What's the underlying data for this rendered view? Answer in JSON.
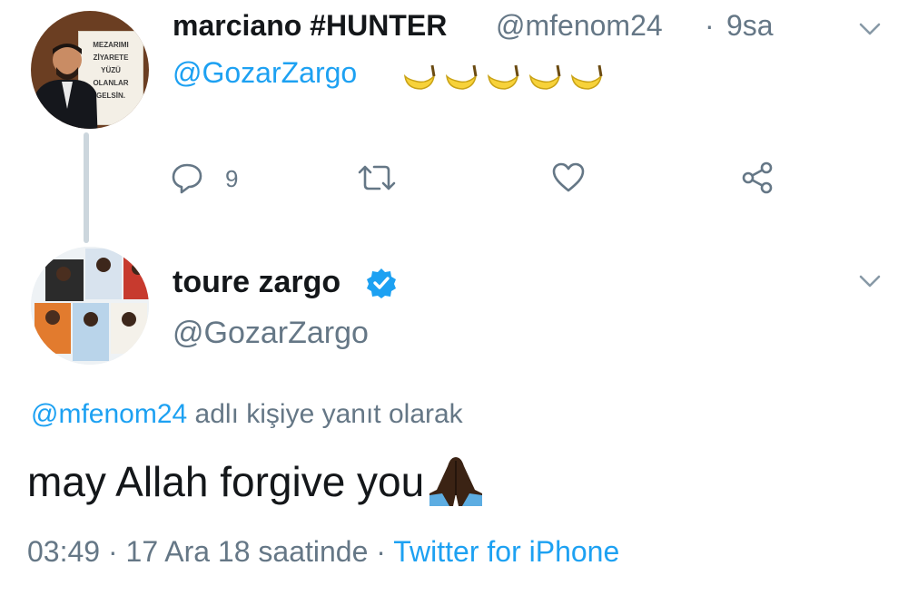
{
  "parent_tweet": {
    "author_name": "marciano #HUNTER",
    "handle": "@mfenom24",
    "separator": "·",
    "time": "9sa",
    "avatar_sign_lines": [
      "MEZARIMI",
      "ZİYARETE",
      "YÜZÜ",
      "OLANLAR",
      "GELSİN."
    ],
    "text_mention": "@GozarZargo",
    "emoji": "banana-emoji",
    "emoji_count": 5,
    "reply_count": "9"
  },
  "reply_tweet": {
    "author_name": "toure zargo",
    "verified": true,
    "handle": "@GozarZargo",
    "replying_mention": "@mfenom24",
    "replying_suffix": " adlı kişiye yanıt olarak",
    "text": "may Allah forgive you",
    "emoji": "folded-hands-emoji",
    "time": "03:49",
    "date_sep": " · ",
    "date": "17 Ara 18 saatinde",
    "source_sep": " · ",
    "source": "Twitter for iPhone"
  },
  "colors": {
    "link": "#1da1f2",
    "secondary_text": "#657786",
    "primary_text": "#14171a",
    "thread_line": "#ccd6dd",
    "icon": "#657786"
  }
}
